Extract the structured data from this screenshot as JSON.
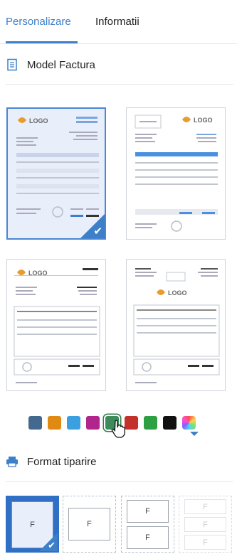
{
  "tabs": [
    {
      "label": "Personalizare",
      "active": true
    },
    {
      "label": "Informatii",
      "active": false
    }
  ],
  "model_section": {
    "title": "Model Factura",
    "icon": "document-icon"
  },
  "templates": [
    {
      "logo_text": "LOGO",
      "selected": true
    },
    {
      "logo_text": "LOGO",
      "selected": false
    },
    {
      "logo_text": "LOGO",
      "selected": false
    },
    {
      "logo_text": "LOGO",
      "selected": false
    }
  ],
  "colors": {
    "swatches": [
      "#44698f",
      "#e08a14",
      "#3aa0e0",
      "#b0268c",
      "#3d8a5a",
      "#c4302b",
      "#2ea044",
      "#111111"
    ],
    "selected_index": 4,
    "custom": "rainbow-picker"
  },
  "format_section": {
    "title": "Format tiparire",
    "icon": "printer-icon"
  },
  "formats": [
    {
      "letter": "F",
      "selected": true
    },
    {
      "letter": "F",
      "selected": false
    },
    {
      "letter": "F",
      "selected": false
    },
    {
      "letter": "F",
      "selected": false
    }
  ],
  "accent": "#3d7fc8"
}
